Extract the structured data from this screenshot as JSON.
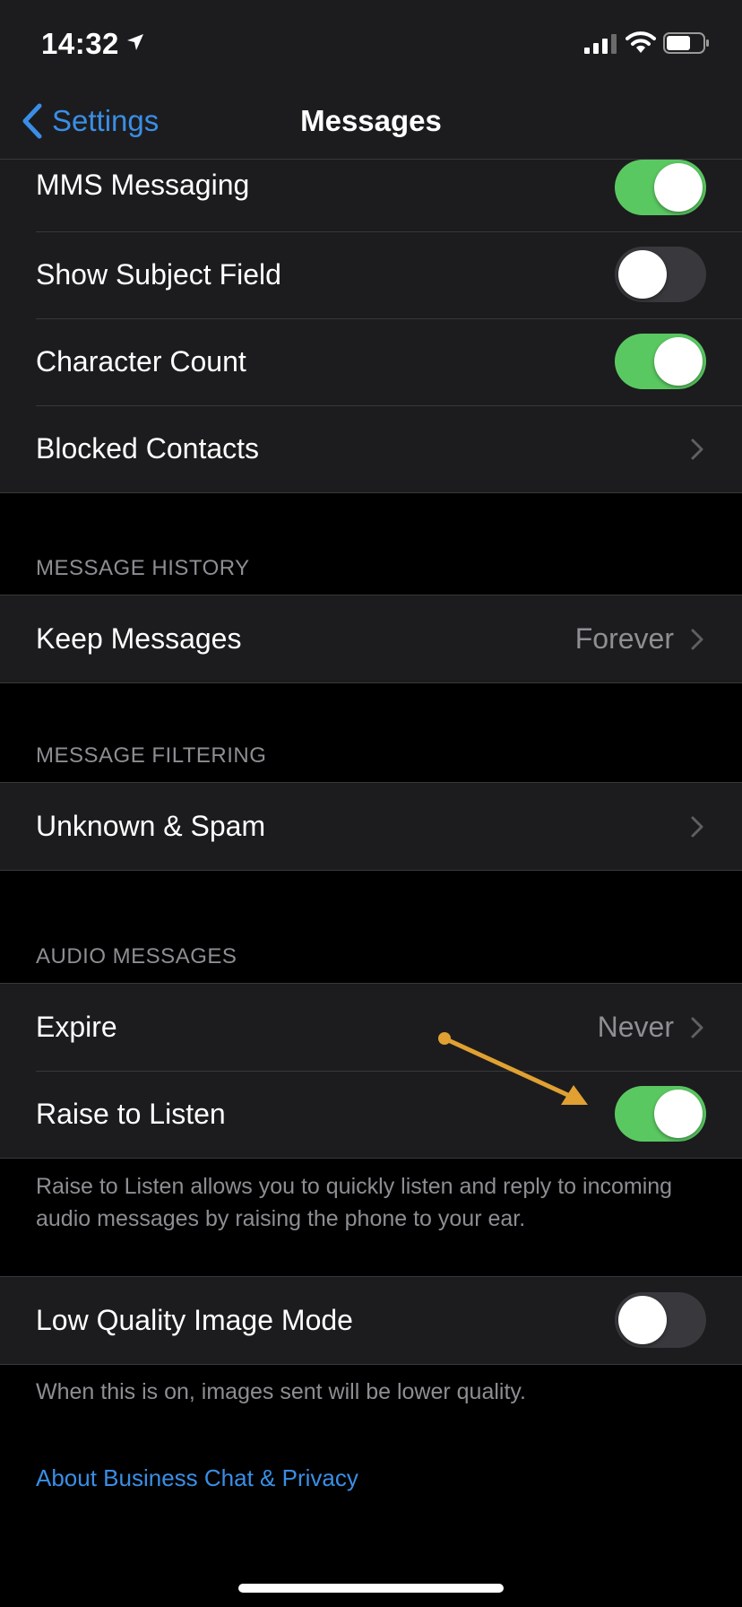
{
  "status_bar": {
    "time": "14:32"
  },
  "nav": {
    "back_label": "Settings",
    "title": "Messages"
  },
  "groups": {
    "general": [
      {
        "label": "MMS Messaging",
        "type": "toggle",
        "on": true
      },
      {
        "label": "Show Subject Field",
        "type": "toggle",
        "on": false
      },
      {
        "label": "Character Count",
        "type": "toggle",
        "on": true
      },
      {
        "label": "Blocked Contacts",
        "type": "link"
      }
    ],
    "history": {
      "header": "MESSAGE HISTORY",
      "keep_label": "Keep Messages",
      "keep_value": "Forever"
    },
    "filtering": {
      "header": "MESSAGE FILTERING",
      "unknown_label": "Unknown & Spam"
    },
    "audio": {
      "header": "AUDIO MESSAGES",
      "expire_label": "Expire",
      "expire_value": "Never",
      "raise_label": "Raise to Listen",
      "raise_on": true,
      "footer": "Raise to Listen allows you to quickly listen and reply to incoming audio messages by raising the phone to your ear."
    },
    "low_quality": {
      "label": "Low Quality Image Mode",
      "on": false,
      "footer": "When this is on, images sent will be lower quality."
    }
  },
  "about_link": "About Business Chat & Privacy",
  "colors": {
    "accent": "#3a8ee6",
    "toggle_on": "#5ac861",
    "annotation": "#e0a132"
  }
}
